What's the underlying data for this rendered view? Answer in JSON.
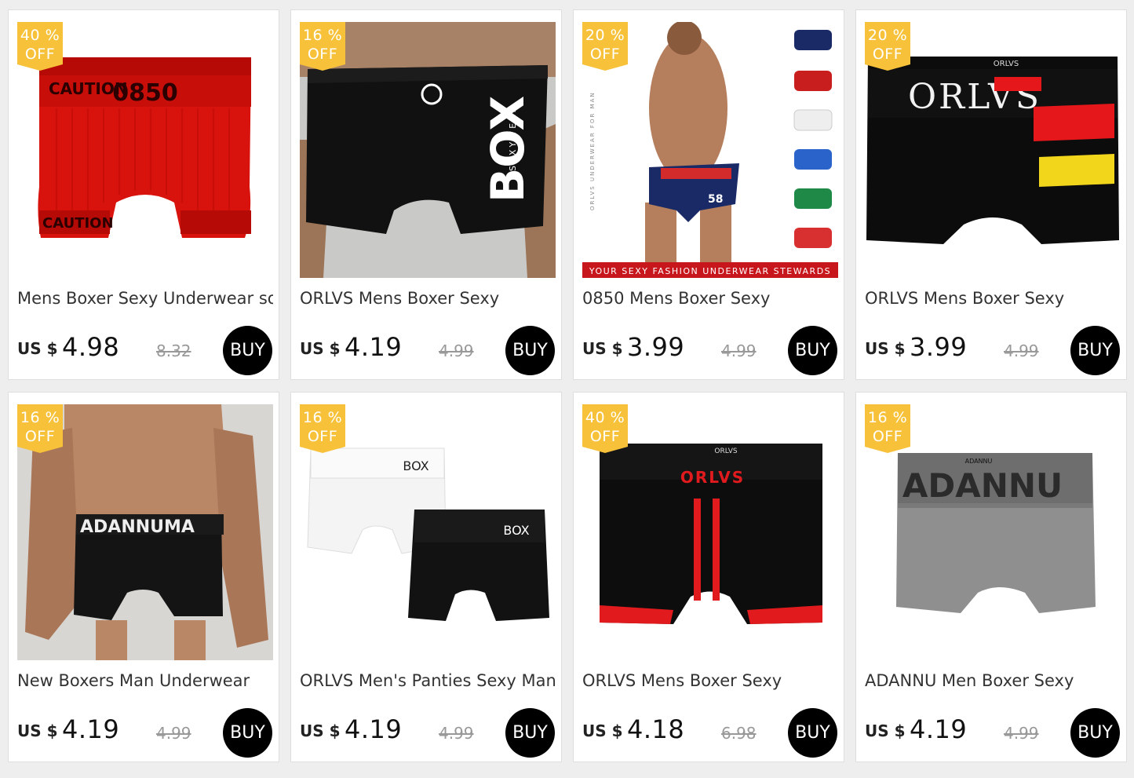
{
  "colors": {
    "badge": "#f7c23a",
    "buy_button": "#000000",
    "old_price": "#999999"
  },
  "products": [
    {
      "discount_line1": "40 %",
      "discount_line2": "OFF",
      "title": "Mens Boxer Sexy Underwear soft",
      "currency": "US $",
      "price": "4.98",
      "old_price": "8.32",
      "buy_label": "BUY",
      "image": "red-boxer-0850-caution",
      "image_text": [
        "0850",
        "CAUTION",
        "CAUTION"
      ]
    },
    {
      "discount_line1": "16 %",
      "discount_line2": "OFF",
      "title": "ORLVS Mens Boxer Sexy",
      "currency": "US $",
      "price": "4.19",
      "old_price": "4.99",
      "buy_label": "BUY",
      "image": "black-boxer-box-model",
      "image_text": [
        "BOX",
        "SEXYWEAR"
      ]
    },
    {
      "discount_line1": "20 %",
      "discount_line2": "OFF",
      "title": "0850 Mens Boxer Sexy",
      "currency": "US $",
      "price": "3.99",
      "old_price": "4.99",
      "buy_label": "BUY",
      "image": "navy-brief-model-variants",
      "image_text": [
        "YOUR SEXY FASHION UNDERWEAR STEWARDS",
        "ORLVS UNDERWEAR FOR MAN",
        "58"
      ]
    },
    {
      "discount_line1": "20 %",
      "discount_line2": "OFF",
      "title": "ORLVS Mens Boxer Sexy",
      "currency": "US $",
      "price": "3.99",
      "old_price": "4.99",
      "buy_label": "BUY",
      "image": "black-boxer-orlvs-red-yellow",
      "image_text": [
        "ORLVS",
        "ORLVS"
      ]
    },
    {
      "discount_line1": "16 %",
      "discount_line2": "OFF",
      "title": "New Boxers Man Underwear",
      "currency": "US $",
      "price": "4.19",
      "old_price": "4.99",
      "buy_label": "BUY",
      "image": "black-boxer-adannu-model",
      "image_text": [
        "ADANNUMA"
      ]
    },
    {
      "discount_line1": "16 %",
      "discount_line2": "OFF",
      "title": "ORLVS Men's Panties Sexy Man",
      "currency": "US $",
      "price": "4.19",
      "old_price": "4.99",
      "buy_label": "BUY",
      "image": "white-black-box-boxers",
      "image_text": [
        "BOX",
        "BOX"
      ]
    },
    {
      "discount_line1": "40 %",
      "discount_line2": "OFF",
      "title": "ORLVS Mens Boxer Sexy",
      "currency": "US $",
      "price": "4.18",
      "old_price": "6.98",
      "buy_label": "BUY",
      "image": "black-boxer-orlvs-red-stripes",
      "image_text": [
        "ORLVS",
        "ORLVS"
      ]
    },
    {
      "discount_line1": "16 %",
      "discount_line2": "OFF",
      "title": "ADANNU Men Boxer Sexy",
      "currency": "US $",
      "price": "4.19",
      "old_price": "4.99",
      "buy_label": "BUY",
      "image": "grey-boxer-adannu",
      "image_text": [
        "ADANNU",
        "ADANNU"
      ]
    }
  ]
}
